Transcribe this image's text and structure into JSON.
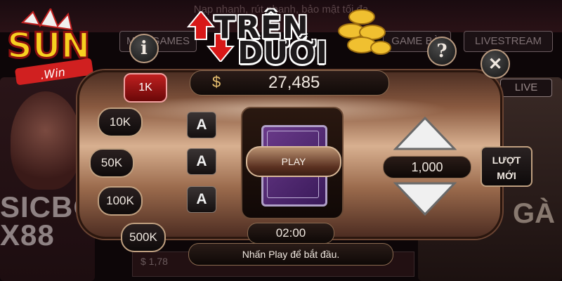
{
  "background": {
    "top_text": "Nạp nhanh, rút nhanh, bảo mật tối đa",
    "tabs": [
      "MINI GAMES",
      "GAME BÀI",
      "LIVESTREAM"
    ],
    "live_badge": "LIVE",
    "left_game": "SICBO X88",
    "right_game": "GÀ",
    "bottom_text": "$ 1,78"
  },
  "logo": {
    "text": "SUN",
    "sub": ".Win"
  },
  "title": {
    "line1": "TRÊN",
    "line2": "DƯỚI"
  },
  "buttons": {
    "info": "i",
    "help": "?",
    "close": "✕",
    "play": "PLAY",
    "new_turn_line1": "LƯỢT",
    "new_turn_line2": "MỚI"
  },
  "balance": {
    "currency": "$",
    "value": "27,485"
  },
  "chips": [
    "1K",
    "10K",
    "50K",
    "100K",
    "500K"
  ],
  "selected_chip": "1K",
  "cards": [
    "A",
    "A",
    "A"
  ],
  "timer": "02:00",
  "bet_amount": "1,000",
  "status": "Nhấn Play để bắt đầu.",
  "colors": {
    "accent_red": "#c02020",
    "gold": "#e8c070",
    "card_purple": "#6a3a8a"
  }
}
